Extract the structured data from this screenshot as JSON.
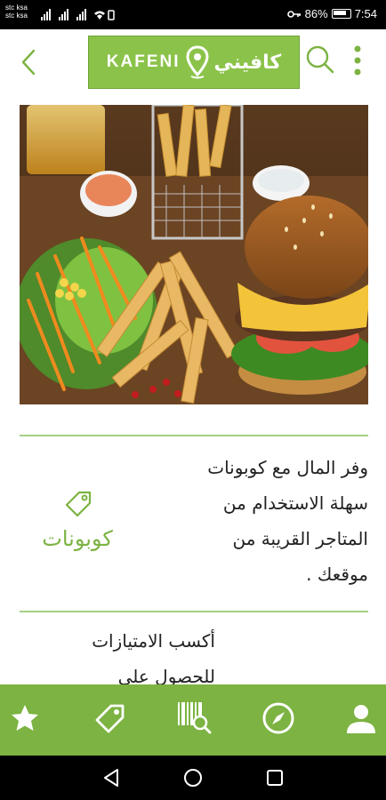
{
  "status_bar": {
    "carrier_1": "stc ksa",
    "carrier_2": "stc ksa",
    "battery": "86%",
    "time": "7:54"
  },
  "header": {
    "logo_latin": "KAFENI",
    "logo_arabic": "كافيني",
    "brand_color": "#8bc34a"
  },
  "hero": {
    "image_subject": "burger-and-fries-photo"
  },
  "cards": [
    {
      "text_lines": [
        "وفر المال مع كوبونات",
        "سهلة الاستخدام من",
        "المتاجر القريبة من",
        "موقعك ."
      ],
      "action_label": "كوبونات",
      "action_icon": "tag-icon"
    },
    {
      "text_lines": [
        "أكسب الامتيازات",
        "للحصول على"
      ]
    }
  ],
  "bottom_nav": {
    "background": "#7cb342",
    "items": [
      "star-icon",
      "tag-icon",
      "barcode-search-icon",
      "compass-icon",
      "profile-icon"
    ]
  },
  "system_nav": [
    "back-icon",
    "home-icon",
    "recents-icon"
  ]
}
